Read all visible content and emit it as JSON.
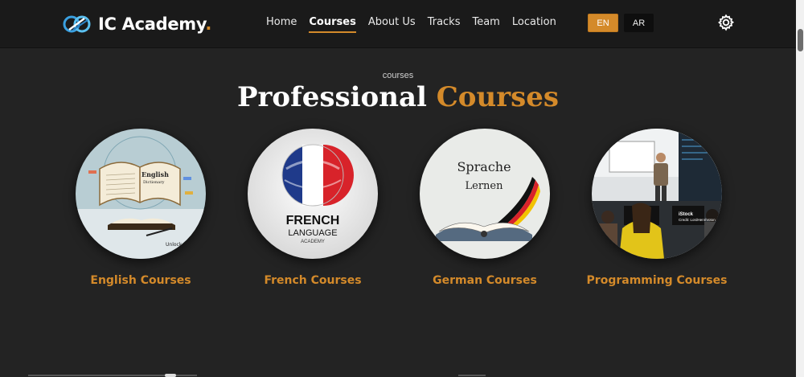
{
  "brand": {
    "name": "IC Academy",
    "dot": "."
  },
  "nav": {
    "items": [
      {
        "label": "Home",
        "active": false
      },
      {
        "label": "Courses",
        "active": true
      },
      {
        "label": "About Us",
        "active": false
      },
      {
        "label": "Tracks",
        "active": false
      },
      {
        "label": "Team",
        "active": false
      },
      {
        "label": "Location",
        "active": false
      }
    ]
  },
  "language": {
    "en": "EN",
    "ar": "AR",
    "selected": "EN"
  },
  "settings_icon": "gear-icon",
  "section": {
    "eyebrow": "courses",
    "title_main": "Professional",
    "title_accent": "Courses"
  },
  "courses": [
    {
      "label": "English Courses",
      "image_text": [
        "English",
        "Dictionary",
        "Unlock"
      ]
    },
    {
      "label": "French Courses",
      "image_text": [
        "FRENCH",
        "LANGUAGE",
        "ACADEMY"
      ]
    },
    {
      "label": "German Courses",
      "image_text": [
        "Sprache",
        "Lernen"
      ]
    },
    {
      "label": "Programming Courses",
      "image_text": [
        "iStock",
        "Credit: LordHenriVoton"
      ]
    }
  ],
  "colors": {
    "accent": "#d48a2a",
    "background": "#232323",
    "navbar": "#1a1a1a"
  }
}
